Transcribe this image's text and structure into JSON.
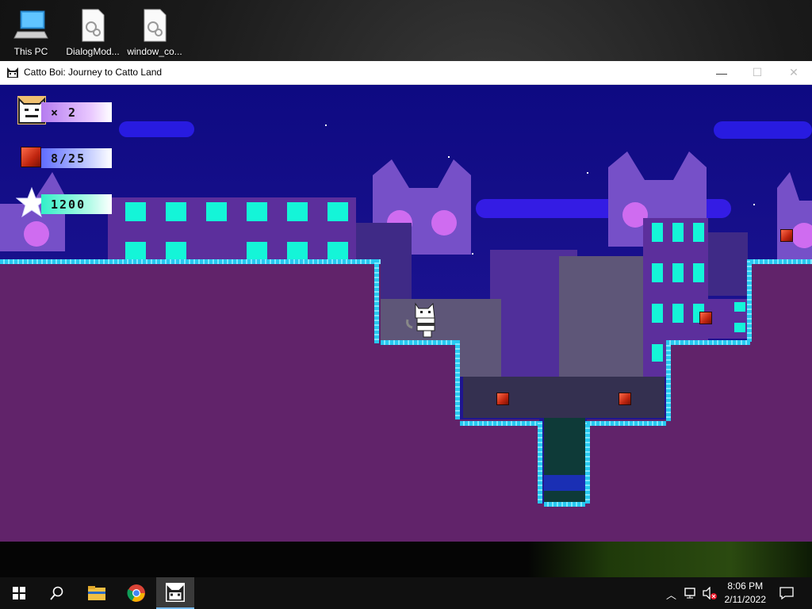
{
  "desktop": {
    "icons": [
      {
        "label": "This PC",
        "icon": "computer-icon"
      },
      {
        "label": "DialogMod...",
        "icon": "settings-file-icon"
      },
      {
        "label": "window_co...",
        "icon": "settings-file-icon"
      }
    ]
  },
  "window": {
    "title": "Catto Boi: Journey to Catto Land",
    "controls": {
      "minimize": "—",
      "maximize": "☐",
      "close": "✕"
    }
  },
  "hud": {
    "lives": "× 2",
    "gems": "8/25",
    "score": "1200"
  },
  "colors": {
    "sky": "#0e0a82",
    "ground": "#61236a",
    "grass": "#27c8f0",
    "building_windows": "#14f5d8",
    "gem": "#c0250f"
  },
  "taskbar": {
    "time": "8:06 PM",
    "date": "2/11/2022"
  }
}
